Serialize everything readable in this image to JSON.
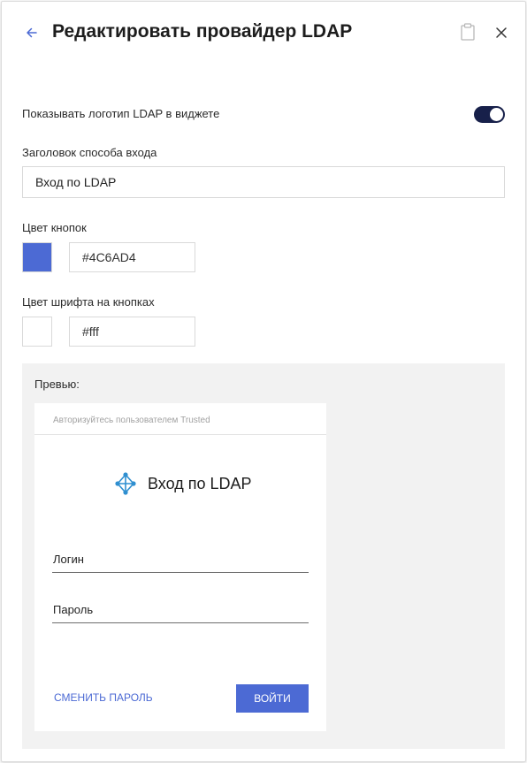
{
  "header": {
    "title": "Редактировать провайдер LDAP",
    "back_icon": "arrow-left-icon",
    "clipboard_icon": "clipboard-icon",
    "close_icon": "close-icon"
  },
  "settings": {
    "show_logo_label": "Показывать логотип LDAP в виджете",
    "show_logo_enabled": true,
    "login_title_label": "Заголовок способа входа",
    "login_title_value": "Вход по LDAP",
    "button_color_label": "Цвет кнопок",
    "button_color_value": "#4C6AD4",
    "button_font_color_label": "Цвет шрифта на кнопках",
    "button_font_color_value": "#fff"
  },
  "preview": {
    "label": "Превью:",
    "widget": {
      "header": "Авторизуйтесь пользователем Trusted",
      "logo_icon": "ldap-network-icon",
      "title": "Вход по LDAP",
      "login_placeholder": "Логин",
      "password_placeholder": "Пароль",
      "change_password": "СМЕНИТЬ ПАРОЛЬ",
      "submit": "ВОЙТИ"
    }
  },
  "colors": {
    "accent": "#4C6AD4",
    "toggle_on": "#17204a",
    "link": "#4c6ad4",
    "logo": "#2f8fd0"
  }
}
